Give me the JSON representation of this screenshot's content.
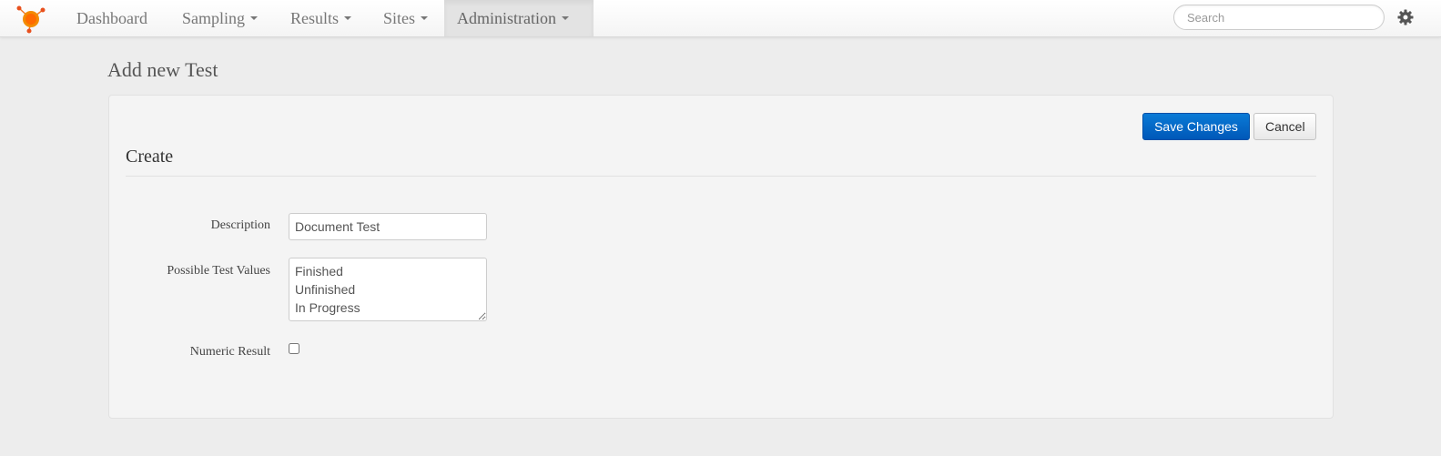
{
  "navbar": {
    "items": [
      {
        "label": "Dashboard",
        "dropdown": false
      },
      {
        "label": "Sampling",
        "dropdown": true
      },
      {
        "label": "Results",
        "dropdown": true
      },
      {
        "label": "Sites",
        "dropdown": true
      },
      {
        "label": "Administration",
        "dropdown": true,
        "active": true
      }
    ],
    "search_placeholder": "Search",
    "icons": {
      "logo": "logo-icon",
      "settings": "gear-icon"
    },
    "brand_color": "#f06a00"
  },
  "page": {
    "title": "Add new Test"
  },
  "toolbar": {
    "save_label": "Save Changes",
    "cancel_label": "Cancel"
  },
  "form": {
    "section_title": "Create",
    "description_label": "Description",
    "description_value": "Document Test",
    "possible_values_label": "Possible Test Values",
    "possible_values_value": "Finished\nUnfinished\nIn Progress",
    "numeric_result_label": "Numeric Result",
    "numeric_result_checked": false
  },
  "colors": {
    "primary_button": "#0a6fcf",
    "page_background": "#ededed",
    "panel_background": "#f4f4f4"
  }
}
